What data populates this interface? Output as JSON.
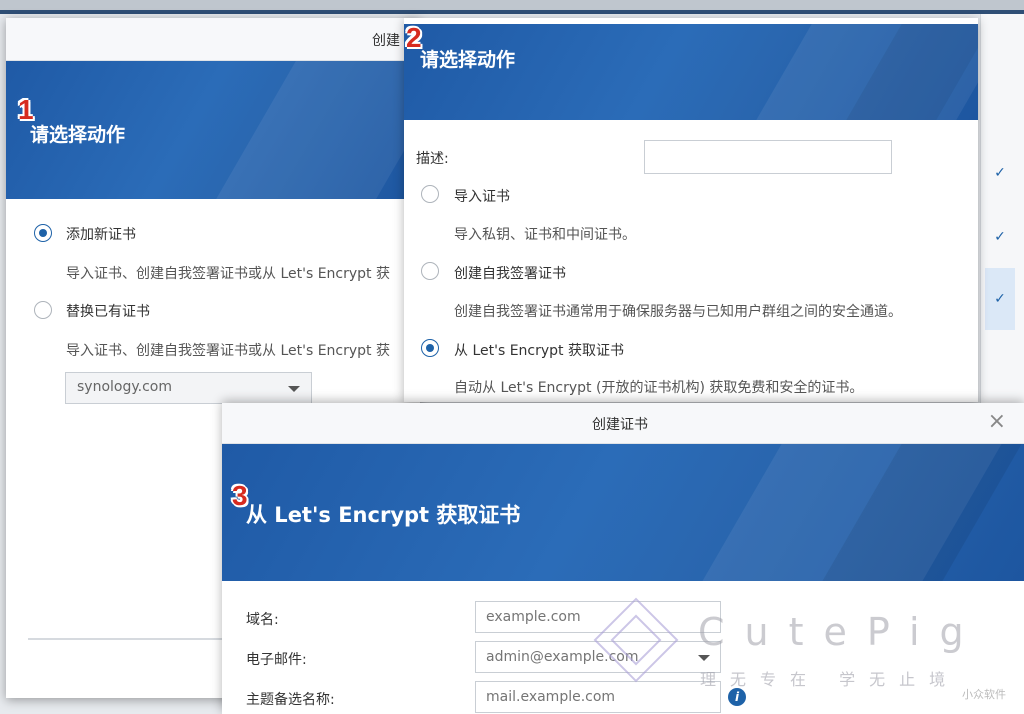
{
  "annotations": {
    "step1": "1",
    "step2": "2",
    "step3": "3"
  },
  "dialog1": {
    "title": "创建",
    "heading": "请选择动作",
    "options": [
      {
        "label": "添加新证书",
        "desc": "导入证书、创建自我签署证书或从 Let's Encrypt 获",
        "selected": true
      },
      {
        "label": "替换已有证书",
        "desc": "导入证书、创建自我签署证书或从 Let's Encrypt 获",
        "selected": false
      }
    ],
    "select_value": "synology.com"
  },
  "dialog2": {
    "heading": "请选择动作",
    "desc_label": "描述:",
    "desc_value": "",
    "options": [
      {
        "label": "导入证书",
        "desc": "导入私钥、证书和中间证书。",
        "selected": false
      },
      {
        "label": "创建自我签署证书",
        "desc": "创建自我签署证书通常用于确保服务器与已知用户群组之间的安全通道。",
        "selected": false
      },
      {
        "label": "从 Let's Encrypt 获取证书",
        "desc": "自动从 Let's Encrypt (开放的证书机构) 获取免费和安全的证书。",
        "selected": true
      }
    ]
  },
  "dialog3": {
    "title": "创建证书",
    "close_icon": "×",
    "heading": "从 Let's Encrypt 获取证书",
    "fields": [
      {
        "label": "域名:",
        "placeholder": "example.com"
      },
      {
        "label": "电子邮件:",
        "placeholder": "admin@example.com"
      },
      {
        "label": "主题备选名称:",
        "placeholder": "mail.example.com"
      }
    ],
    "info_icon": "i"
  },
  "background": {
    "checks": [
      "✓",
      "✓",
      "✓"
    ]
  },
  "watermark": {
    "brand": "CutePig",
    "slogan": "理无专在 学无止境",
    "corner": "小众软件"
  },
  "colors": {
    "accent": "#1e62a8",
    "banner": "#2463ad",
    "step": "#d62b1f"
  }
}
